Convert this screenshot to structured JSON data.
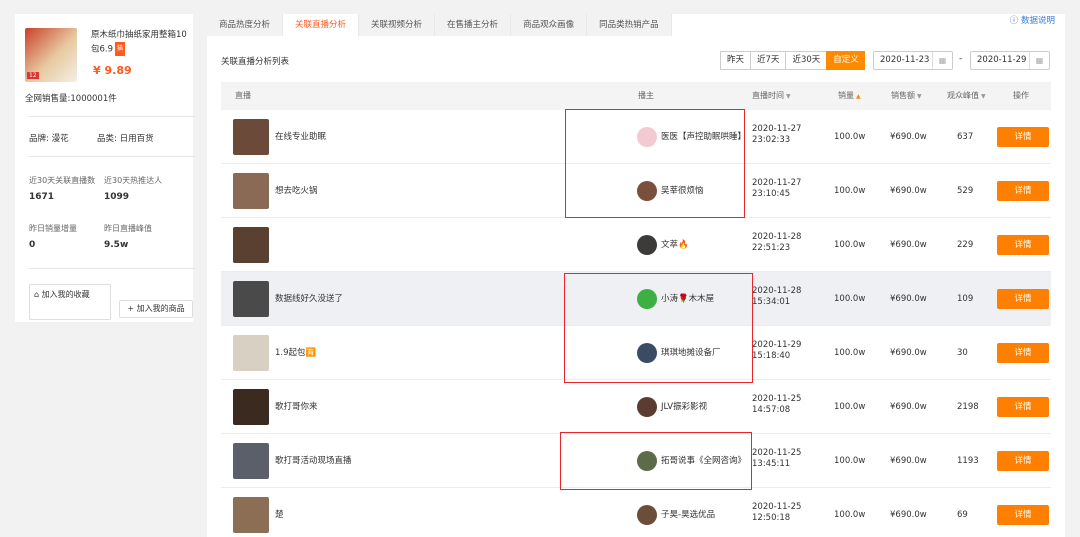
{
  "product": {
    "name": "原木纸巾抽纸家用整箱10包6.9",
    "badge": "猫",
    "image_tag": "12",
    "price": "¥ 9.89",
    "total_sales_label": "全网销售量:",
    "total_sales_value": "1000001件",
    "brand_label": "品牌:",
    "brand_value": "漫花",
    "category_label": "品类:",
    "category_value": "日用百货",
    "stats": [
      {
        "label": "近30天关联直播数",
        "value": "1671"
      },
      {
        "label": "近30天热推达人",
        "value": "1099"
      },
      {
        "label": "昨日销量增量",
        "value": "0"
      },
      {
        "label": "昨日直播峰值",
        "value": "9.5w"
      }
    ],
    "fav_button": "加入我的收藏",
    "add_button": "加入我的商品"
  },
  "tabs": [
    "商品热度分析",
    "关联直播分析",
    "关联视频分析",
    "在售播主分析",
    "商品观众画像",
    "同品类热销产品"
  ],
  "active_tab": 1,
  "help_link": "数据说明",
  "list_title": "关联直播分析列表",
  "ranges": [
    "昨天",
    "近7天",
    "近30天",
    "自定义"
  ],
  "active_range": 3,
  "date_start": "2020-11-23",
  "date_end": "2020-11-29",
  "date_sep": "-",
  "columns": {
    "live": "直播",
    "anchor": "播主",
    "time": "直播时间",
    "sales": "销量",
    "amount": "销售额",
    "viewers": "观众峰值",
    "action": "操作"
  },
  "rows": [
    {
      "title": "在线专业助眠",
      "anchor": "医医【声控助眠哄睡】",
      "date": "2020-11-27",
      "clock": "23:02:33",
      "sales": "100.0w",
      "amount": "¥690.0w",
      "viewers": "637",
      "thumb": "#6b4a3a",
      "avatar": "#f3c9d2"
    },
    {
      "title": "想去吃火锅",
      "anchor": "吴莘很烦恼",
      "date": "2020-11-27",
      "clock": "23:10:45",
      "sales": "100.0w",
      "amount": "¥690.0w",
      "viewers": "529",
      "thumb": "#8a6a55",
      "avatar": "#7a4f3e"
    },
    {
      "title": "",
      "anchor": "文萃🔥",
      "date": "2020-11-28",
      "clock": "22:51:23",
      "sales": "100.0w",
      "amount": "¥690.0w",
      "viewers": "229",
      "thumb": "#5a4030",
      "avatar": "#3d3a3a"
    },
    {
      "title": "数据线好久没送了",
      "anchor": "小涛🌹木木屋",
      "date": "2020-11-28",
      "clock": "15:34:01",
      "sales": "100.0w",
      "amount": "¥690.0w",
      "viewers": "109",
      "thumb": "#4a4a4a",
      "avatar": "#3cb043"
    },
    {
      "title": "1.9起包🈶",
      "anchor": "琪琪地摊设备厂",
      "date": "2020-11-29",
      "clock": "15:18:40",
      "sales": "100.0w",
      "amount": "¥690.0w",
      "viewers": "30",
      "thumb": "#d8d0c2",
      "avatar": "#3b4b63"
    },
    {
      "title": "歌打哥你来",
      "anchor": "JLV振彩影视",
      "date": "2020-11-25",
      "clock": "14:57:08",
      "sales": "100.0w",
      "amount": "¥690.0w",
      "viewers": "2198",
      "thumb": "#3a2a20",
      "avatar": "#5a3d30"
    },
    {
      "title": "歌打哥活动现场直播",
      "anchor": "拓哥说事《全网咨询》",
      "date": "2020-11-25",
      "clock": "13:45:11",
      "sales": "100.0w",
      "amount": "¥690.0w",
      "viewers": "1193",
      "thumb": "#5a5f6a",
      "avatar": "#5d6b48"
    },
    {
      "title": "楚",
      "anchor": "子昊-昊选优品",
      "date": "2020-11-25",
      "clock": "12:50:18",
      "sales": "100.0w",
      "amount": "¥690.0w",
      "viewers": "69",
      "thumb": "#8a6f55",
      "avatar": "#6a4e3a"
    }
  ],
  "detail_label": "详情",
  "colors": {
    "accent": "#ff8000",
    "price": "#ff5a1f",
    "highlight": "#e8262b",
    "link": "#3a7bd5"
  }
}
